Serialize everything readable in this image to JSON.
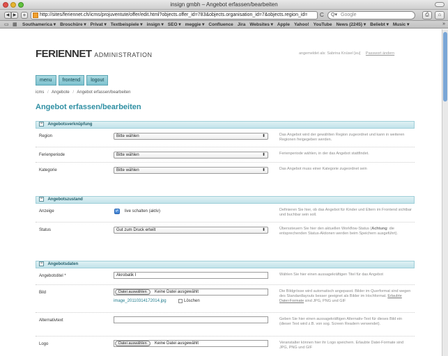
{
  "window": {
    "title": "insign gmbh – Angebot erfassen/bearbeiten"
  },
  "toolbar": {
    "back_label": "◀",
    "forward_label": "▶",
    "add_label": "+",
    "url": "http://sites/feriennet.ch/icms/projuventute/offer/edit.html?objects.offer_id=783&objects.organisation_id=7&objects.region_id=",
    "reload_label": "C",
    "search_placeholder": "Google",
    "search_prefix": "Q▾",
    "print_label": "⎙",
    "home_label": "⌂"
  },
  "bookmarks": {
    "items": [
      "Southamerica ▾",
      "Broschüre ▾",
      "Privat ▾",
      "Textbeispiele ▾",
      "insign ▾",
      "SEO ▾",
      "meggie ▾",
      "Confluence",
      "Jira",
      "Websites ▾",
      "Apple",
      "Yahoo!",
      "YouTube",
      "News (2245) ▾",
      "Beliebt ▾",
      "Music ▾"
    ],
    "more_label": "»"
  },
  "header": {
    "logo_main": "FERIENNET",
    "logo_sub": "ADMINISTRATION",
    "login_text": "angemeldet als: Sabrina Knüsel [eu]",
    "password_link": "Passwort ändern"
  },
  "menu": {
    "items": [
      "menu",
      "frontend",
      "logout"
    ]
  },
  "breadcrumb": {
    "items": [
      "icms",
      "Angebote",
      "Angebot erfassen/bearbeiten"
    ],
    "separator": "/"
  },
  "page_title": "Angebot erfassen/bearbeiten",
  "sections": {
    "verknuepfung": {
      "title": "Angebotsverknüpfung",
      "toggle": "−",
      "rows": {
        "region": {
          "label": "Region",
          "value": "Bitte wählen",
          "help": "Das Angebot wird der gewählten Region zugeordnet und kann in weiteren Regionen freigegeben werden."
        },
        "ferienperiode": {
          "label": "Ferienperiode",
          "value": "Bitte wählen",
          "help": "Ferienperiode wählen, in der das Angebot stattfindet."
        },
        "kategorie": {
          "label": "Kategorie",
          "value": "Bitte wählen",
          "help": "Das Angebot muss einer Kategorie zugeordnet sein"
        }
      }
    },
    "zustand": {
      "title": "Angebotszustand",
      "toggle": "−",
      "rows": {
        "anzeige": {
          "label": "Anzeige",
          "check_label": "live schalten (aktiv)",
          "checked": true,
          "help": "Definieren Sie hier, ob das Angebot für Kinder und Eltern im Frontend sichtbar und buchbar sein soll."
        },
        "status": {
          "label": "Status",
          "value": "Gut zum Druck erteilt",
          "help_pre": "Überssteuern Sie hier den aktuellen Workflow-Status (",
          "help_bold": "Achtung",
          "help_post": ": die entsprechenden Status-Aktionen werden beim Speichern ausgeführt)."
        }
      }
    },
    "daten": {
      "title": "Angebotsdaten",
      "toggle": "−",
      "rows": {
        "titel": {
          "label": "Angebotstitel *",
          "value": "Akrobatik I",
          "help": "Wählen Sie hier einen aussagekräftigen Titel für das Angebot"
        },
        "bild": {
          "label": "Bild",
          "button": "Datei auswählen",
          "status": "Keine Datei ausgewählt",
          "filename": "image_20110314172014.jpg",
          "delete_label": "Löschen",
          "help": "Die Bildgrösse wird automatisch angepasst. Bilder im Querformat sind wegen des Standardlayouts besser geeignet als Bilder im Hochformat.",
          "help_link": "Erlaubte Datei-Formate",
          "help_tail": " sind JPG, PNG und GIF"
        },
        "alttext": {
          "label": "Alternativtext",
          "value": "",
          "help": "Geben Sie hier einen aussagekräftigen Alternativ-Text für dieses Bild ein (dieser Text wird z.B. von sog. Screen Readern verwendet)."
        },
        "logo": {
          "label": "Logo",
          "button": "Datei auswählen",
          "status": "Keine Datei ausgewählt",
          "help": "Veranstalter können hier ihr Logo speichern. Erlaubte Datei-Formate sind JPG, PNG und GIF"
        }
      }
    }
  },
  "colors": {
    "accent": "#2f8fa3",
    "menu_button": "#7ec2cf",
    "section_header": "#c2e3ea"
  }
}
